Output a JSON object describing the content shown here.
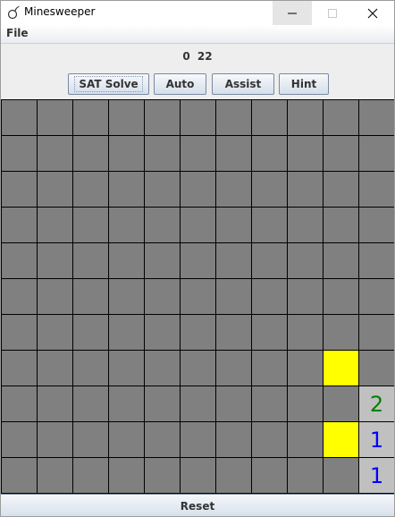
{
  "window": {
    "title": "Minesweeper",
    "icon": "bomb-icon"
  },
  "menu": {
    "file": "File"
  },
  "status": {
    "left_count": "0",
    "right_count": "22"
  },
  "toolbar": {
    "sat_solve": "SAT Solve",
    "auto": "Auto",
    "assist": "Assist",
    "hint": "Hint"
  },
  "reset": "Reset",
  "colors": {
    "unrevealed": "#808080",
    "revealed": "#c0c0c0",
    "flagged": "#ffff00",
    "grid": "#000000",
    "number_1": "#0000ff",
    "number_2": "#008000"
  },
  "board": {
    "rows": 11,
    "cols": 11,
    "grid": [
      [
        "h",
        "h",
        "h",
        "h",
        "h",
        "h",
        "h",
        "h",
        "h",
        "h",
        "h"
      ],
      [
        "h",
        "h",
        "h",
        "h",
        "h",
        "h",
        "h",
        "h",
        "h",
        "h",
        "h"
      ],
      [
        "h",
        "h",
        "h",
        "h",
        "h",
        "h",
        "h",
        "h",
        "h",
        "h",
        "h"
      ],
      [
        "h",
        "h",
        "h",
        "h",
        "h",
        "h",
        "h",
        "h",
        "h",
        "h",
        "h"
      ],
      [
        "h",
        "h",
        "h",
        "h",
        "h",
        "h",
        "h",
        "h",
        "h",
        "h",
        "h"
      ],
      [
        "h",
        "h",
        "h",
        "h",
        "h",
        "h",
        "h",
        "h",
        "h",
        "h",
        "h"
      ],
      [
        "h",
        "h",
        "h",
        "h",
        "h",
        "h",
        "h",
        "h",
        "h",
        "h",
        "h"
      ],
      [
        "h",
        "h",
        "h",
        "h",
        "h",
        "h",
        "h",
        "h",
        "h",
        "f",
        "h"
      ],
      [
        "h",
        "h",
        "h",
        "h",
        "h",
        "h",
        "h",
        "h",
        "h",
        "h",
        "2"
      ],
      [
        "h",
        "h",
        "h",
        "h",
        "h",
        "h",
        "h",
        "h",
        "h",
        "f",
        "1"
      ],
      [
        "h",
        "h",
        "h",
        "h",
        "h",
        "h",
        "h",
        "h",
        "h",
        "h",
        "1"
      ]
    ]
  }
}
